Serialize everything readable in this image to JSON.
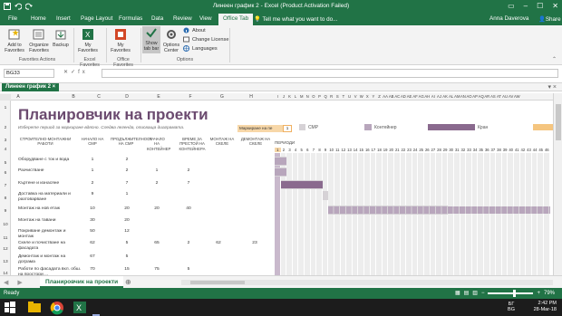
{
  "window": {
    "title": "Линеен график 2 - Excel (Product Activation Failed)",
    "user": "Anna Daverova",
    "share": "Share",
    "tell_me": "Tell me what you want to do..."
  },
  "tabs": [
    "File",
    "Home",
    "Insert",
    "Page Layout",
    "Formulas",
    "Data",
    "Review",
    "View",
    "Office Tab"
  ],
  "active_tab": "Office Tab",
  "ribbon": {
    "add_to_favorites": "Add to Favorites",
    "organize_favorites": "Organize Favorites",
    "backup": "Backup",
    "my_favorites_1": "My Favorites",
    "my_favorites_2": "My Favorites",
    "show_tab_bar": "Show tab bar",
    "options_center": "Options Center",
    "about": "About",
    "change_license": "Change License",
    "languages": "Languages",
    "group_favorites_actions": "Favorites Actions",
    "group_excel_favorites": "Excel Favorites",
    "group_office_favorites": "Office Favorites",
    "group_options": "Options"
  },
  "formula_bar": {
    "name_box": "BG33",
    "value": ""
  },
  "favorites_tab": "Линеен график 2",
  "columns": [
    "A",
    "B",
    "C",
    "D",
    "E",
    "F",
    "G",
    "H",
    "I",
    "J",
    "K",
    "L",
    "M",
    "N",
    "O",
    "P",
    "Q",
    "R",
    "S",
    "T",
    "U",
    "V",
    "W",
    "X",
    "Y",
    "Z",
    "AA",
    "AB",
    "AC",
    "AD",
    "AE",
    "AF",
    "AG",
    "AH",
    "AI",
    "AJ",
    "AK",
    "AL",
    "AM",
    "AN",
    "AO",
    "AP",
    "AQ",
    "AR",
    "AS",
    "AT",
    "AU",
    "AV",
    "AW"
  ],
  "rows": [
    "1",
    "2",
    "3",
    "4",
    "5",
    "6",
    "7",
    "8",
    "9",
    "10",
    "11",
    "12",
    "13",
    "14",
    "15",
    "16",
    "17",
    "18",
    "19",
    "20",
    "21",
    "22"
  ],
  "sheet": {
    "title": "Планировчик на проекти",
    "subtitle": "Изберете период за маркиране вдясно. Следва легенда, описваща диаграмата.",
    "marker_label": "Маркиране на пе",
    "marker_value": "1",
    "legend": [
      {
        "label": "СМР",
        "color": "#d6d2d6"
      },
      {
        "label": "Контейнер",
        "color": "#b8a6bc"
      },
      {
        "label": "Кран",
        "color": "#8a6a8e"
      }
    ],
    "headers": {
      "activity": "СТРОИТЕЛНО-МОНТАЖНИ РАБОТИ",
      "plan_start": "НАЧАЛО НА СМР",
      "plan_duration": "ПРОДЪЛЖИТЕЛНОСТ НА СМР",
      "actual_start": "НАЧАЛО НА КОНТЕЙНЕР",
      "actual_duration": "ВРЕМЕ ЗА ПРЕСТОЙ НА КОНТЕЙНЕРА",
      "crane_start": "МОНТАЖ НА СКЕЛЕ",
      "crane_duration": "ДЕМОНТАЖ НА СКЕЛЕ",
      "periods": "ПЕРИОДИ"
    },
    "period_numbers": [
      "1",
      "2",
      "3",
      "4",
      "5",
      "6",
      "7",
      "8",
      "9",
      "10",
      "11",
      "12",
      "13",
      "14",
      "15",
      "16",
      "17",
      "18",
      "19",
      "20",
      "21",
      "22",
      "23",
      "24",
      "25",
      "26",
      "27",
      "28",
      "29",
      "30",
      "31",
      "32",
      "33",
      "34",
      "35",
      "36",
      "37",
      "38",
      "39",
      "40",
      "41",
      "42",
      "43",
      "44",
      "45",
      "46"
    ],
    "tasks": [
      {
        "name": "Оборудване с ток и вода",
        "a": "1",
        "b": "2",
        "c": "",
        "d": "",
        "e": "",
        "f": ""
      },
      {
        "name": "Разчистване",
        "a": "1",
        "b": "2",
        "c": "1",
        "d": "2",
        "e": "",
        "f": ""
      },
      {
        "name": "Къртене и изнасяне",
        "a": "2",
        "b": "7",
        "c": "2",
        "d": "7",
        "e": "",
        "f": ""
      },
      {
        "name": "Доставка на материали и разтоварване",
        "a": "9",
        "b": "1",
        "c": "",
        "d": "",
        "e": "",
        "f": ""
      },
      {
        "name": "Монтаж на нов етаж",
        "a": "10",
        "b": "20",
        "c": "20",
        "d": "40",
        "e": "",
        "f": ""
      },
      {
        "name": "Монтаж на тавани",
        "a": "30",
        "b": "20",
        "c": "",
        "d": "",
        "e": "",
        "f": ""
      },
      {
        "name": "Покриване демонтаж и монтаж",
        "a": "50",
        "b": "12",
        "c": "",
        "d": "",
        "e": "",
        "f": ""
      },
      {
        "name": "Скеле и почистване на фасадата",
        "a": "62",
        "b": "5",
        "c": "65",
        "d": "2",
        "e": "62",
        "f": "23"
      },
      {
        "name": "Демонтаж и монтаж на дограма",
        "a": "67",
        "b": "5",
        "c": "",
        "d": "",
        "e": "",
        "f": ""
      },
      {
        "name": "Работи по фасадата вкл. обш. на простори ...",
        "a": "70",
        "b": "15",
        "c": "75",
        "d": "5",
        "e": "",
        "f": ""
      }
    ]
  },
  "sheet_tab": "Планировчик на проекти",
  "status": {
    "ready": "Ready",
    "zoom": "79%"
  },
  "taskbar": {
    "lang": "БГ",
    "lang2": "BG",
    "time": "2:42 PM",
    "date": "28-Mar-18"
  },
  "colors": {
    "excel_green": "#217346",
    "title_purple": "#6b4a6f",
    "bar_light": "#d6d2d6",
    "bar_mid": "#b8a6bc",
    "bar_dark": "#8a6a8e"
  },
  "chart_data": {
    "type": "table",
    "gantt": [
      {
        "task": "Оборудване с ток и вода",
        "start": 1,
        "duration": 2
      },
      {
        "task": "Разчистване",
        "start": 1,
        "duration": 2
      },
      {
        "task": "Къртене и изнасяне",
        "start": 2,
        "duration": 7
      },
      {
        "task": "Доставка на материали и разтоварване",
        "start": 9,
        "duration": 1
      },
      {
        "task": "Монтаж на нов етаж",
        "start": 10,
        "duration": 20
      }
    ]
  }
}
